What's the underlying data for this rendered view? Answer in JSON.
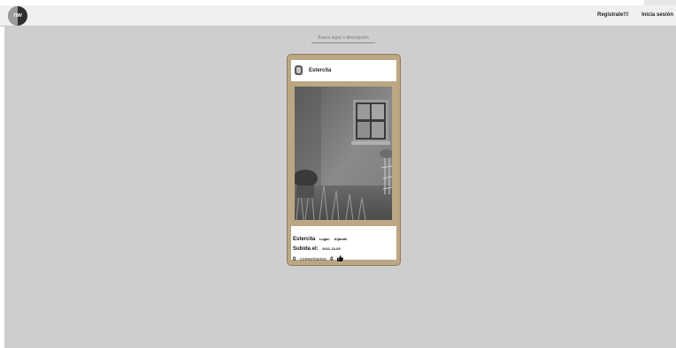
{
  "header": {
    "logo_text": "nw",
    "register_label": "Registrate!!!",
    "login_label": "Inicia sesión"
  },
  "search": {
    "placeholder": "Busca lugar o descripción"
  },
  "post": {
    "user": "Estercita",
    "author": "Estercita",
    "place_label": "Lugar:",
    "place": "Aljarafe",
    "uploaded_label": "Subida el:",
    "uploaded_date": "2021-10-05",
    "comments_count": "0",
    "comments_label": "comentarios",
    "likes_count": "0",
    "like_icon": "thumbs-up-icon"
  },
  "colors": {
    "frame": "#bca785",
    "background": "#cecece",
    "header": "#f0f0f0"
  }
}
